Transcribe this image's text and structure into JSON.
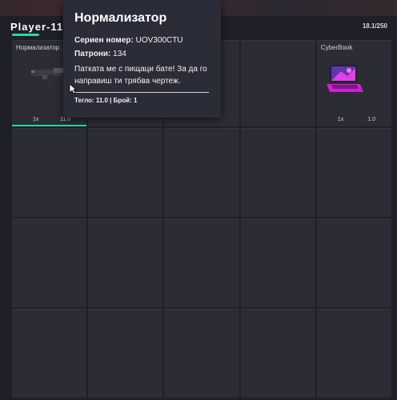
{
  "header": {
    "player_name": "Player-110",
    "weight": "18.1/250"
  },
  "slots": [
    {
      "title": "Нормализатор",
      "count": "1x",
      "weight": "11.0",
      "icon": "pistol-icon",
      "durability_fraction": 1.0
    },
    {
      "title": "CyberBook",
      "count": "1x",
      "weight": "1.0",
      "icon": "laptop-icon"
    }
  ],
  "tooltip": {
    "title": "Нормализатор",
    "serial_label": "Сериен номер:",
    "serial_value": "UOV300CTU",
    "ammo_label": "Патрони:",
    "ammo_value": "134",
    "description": "Патката ме с пищаци бате! За да го направиш ти трябва чертеж.",
    "footer": "Тегло: 11.0 | Брой: 1"
  },
  "colors": {
    "accent": "#26d9a5",
    "laptop_magenta": "#e040e8"
  }
}
